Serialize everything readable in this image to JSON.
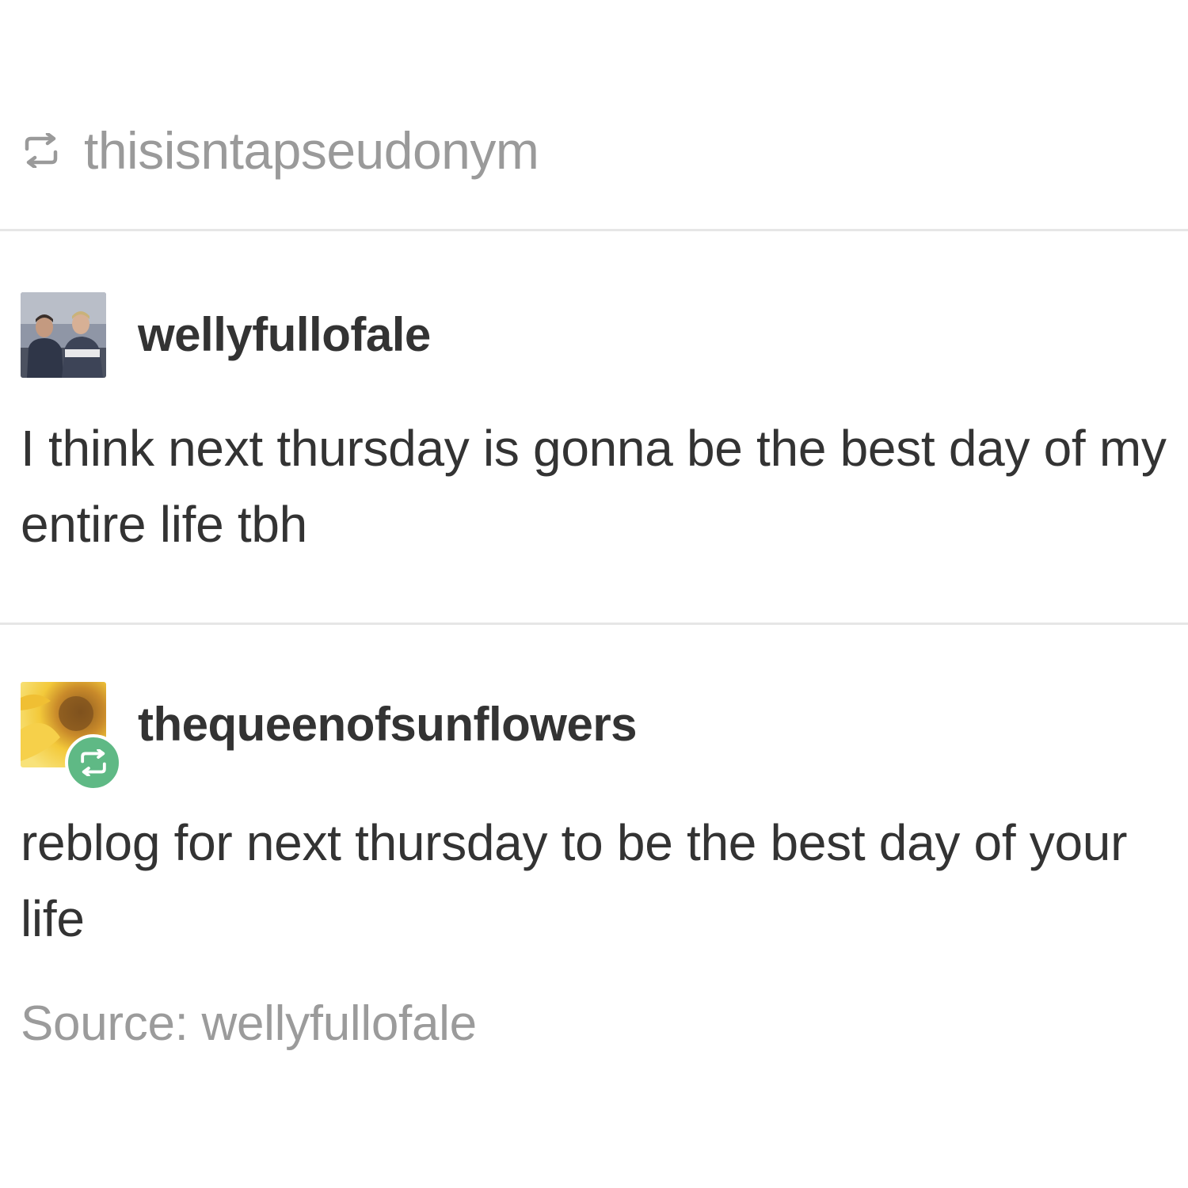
{
  "reblog_header": {
    "icon": "reblog-icon",
    "username": "thisisntapseudonym"
  },
  "posts": [
    {
      "username": "wellyfullofale",
      "avatar": "photo-avatar",
      "text": "I think next thursday is gonna be the best day of my entire life tbh"
    },
    {
      "username": "thequeenofsunflowers",
      "avatar": "sunflower-avatar",
      "badge_icon": "reblog-icon",
      "text": "reblog for next thursday to be the best day of your life"
    }
  ],
  "source": {
    "text": "Source: wellyfullofale"
  },
  "colors": {
    "muted_text": "#9a9a9a",
    "body_text": "#333333",
    "divider": "#e6e6e6",
    "reblog_green": "#5fb985"
  }
}
